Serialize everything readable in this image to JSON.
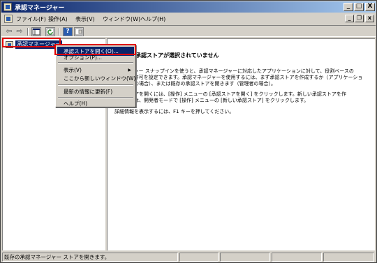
{
  "window": {
    "title": "承認マネージャー",
    "caption_buttons": {
      "minimize": "_",
      "restore": "□",
      "close": "X"
    }
  },
  "menubar": {
    "items": [
      "ファイル(F)",
      "操作(A)",
      "表示(V)",
      "ウィンドウ(W)",
      "ヘルプ(H)"
    ],
    "child_buttons": {
      "minimize": "_",
      "restore": "❐",
      "close": "x"
    }
  },
  "toolbar": {
    "back": "⇦",
    "forward": "⇨",
    "help": "?"
  },
  "tree": {
    "root_label": "承認マネージャー"
  },
  "content": {
    "heading": "承認ストアが選択されていません",
    "lines": [
      "マネージャー スナップインを使うと、承認マネージャーに対応したアプリケーションに対して、役割ベースの",
      "アクセス許可を設定できます。承認マネージャーを使用するには、まず承認ストアを作成するか（アプリケーショ",
      "ン開発者の場合）、または既存の承認ストアを開きます（管理者の場合）。",
      "",
      "承認ストアを開くには、[操作] メニューの [承認ストアを開く] をクリックします。新しい承認ストアを作",
      "成するには、開発者モードで [操作] メニューの [新しい承認ストア] をクリックします。",
      "",
      "詳細情報を表示するには、F1 キーを押してください。"
    ]
  },
  "context_menu": {
    "open_store": "承認ストアを開く(O)...",
    "options": "オプション(P)...",
    "view": "表示(V)",
    "new_window": "ここから新しいウィンドウ(W)",
    "refresh": "最新の情報に更新(F)",
    "help": "ヘルプ(H)"
  },
  "statusbar": {
    "text": "既存の承認マネージャー ストアを開きます。"
  },
  "colors": {
    "title_start": "#0a246a",
    "title_end": "#a6caf0",
    "highlight": "#0a246a",
    "annotation_red": "#e00000",
    "face": "#d4d0c8"
  }
}
